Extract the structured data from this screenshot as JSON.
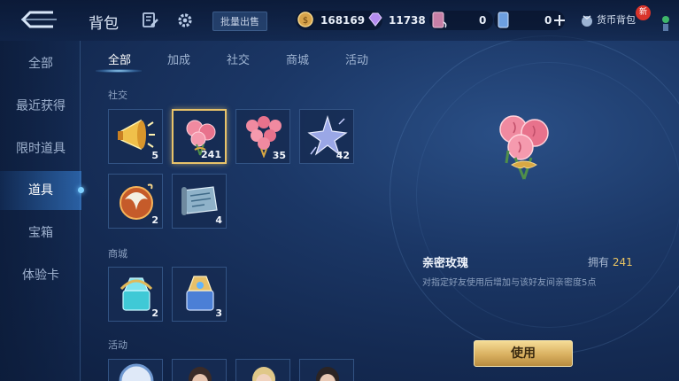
{
  "header": {
    "title": "背包",
    "batch_sell_label": "批量出售",
    "currencies": [
      {
        "icon": "gold-coin-icon",
        "value": "168169"
      },
      {
        "icon": "diamond-icon",
        "value": "11738"
      },
      {
        "icon": "ticket-icon",
        "value": "0"
      },
      {
        "icon": "card-icon",
        "value": "0"
      }
    ],
    "coin_bag_label": "货币背包",
    "new_badge": "新"
  },
  "sidebar": {
    "items": [
      {
        "label": "全部",
        "active": false
      },
      {
        "label": "最近获得",
        "active": false
      },
      {
        "label": "限时道具",
        "active": false
      },
      {
        "label": "道具",
        "active": true
      },
      {
        "label": "宝箱",
        "active": false
      },
      {
        "label": "体验卡",
        "active": false
      }
    ]
  },
  "tabs": [
    {
      "label": "全部",
      "active": true
    },
    {
      "label": "加成",
      "active": false
    },
    {
      "label": "社交",
      "active": false
    },
    {
      "label": "商城",
      "active": false
    },
    {
      "label": "活动",
      "active": false
    }
  ],
  "sections": {
    "social": {
      "title": "社交",
      "items": [
        {
          "icon": "megaphone-icon",
          "count": "5"
        },
        {
          "icon": "rose-icon",
          "count": "241",
          "selected": true
        },
        {
          "icon": "rose-bouquet-icon",
          "count": "35"
        },
        {
          "icon": "star-charm-icon",
          "count": "42"
        },
        {
          "icon": "phoenix-emblem-icon",
          "count": "2"
        },
        {
          "icon": "scroll-book-icon",
          "count": "4"
        }
      ]
    },
    "mall": {
      "title": "商城",
      "items": [
        {
          "icon": "cyan-crystal-chest-icon",
          "count": "2"
        },
        {
          "icon": "gold-crystal-chest-icon",
          "count": "3"
        }
      ]
    },
    "event": {
      "title": "活动"
    }
  },
  "detail": {
    "name": "亲密玫瑰",
    "owned_label": "拥有",
    "owned_value": "241",
    "description": "对指定好友使用后增加与该好友间亲密度5点",
    "use_label": "使用"
  },
  "colors": {
    "accent_gold": "#e9c463",
    "selected_border": "#e8c36a",
    "badge_red": "#d9342b"
  }
}
